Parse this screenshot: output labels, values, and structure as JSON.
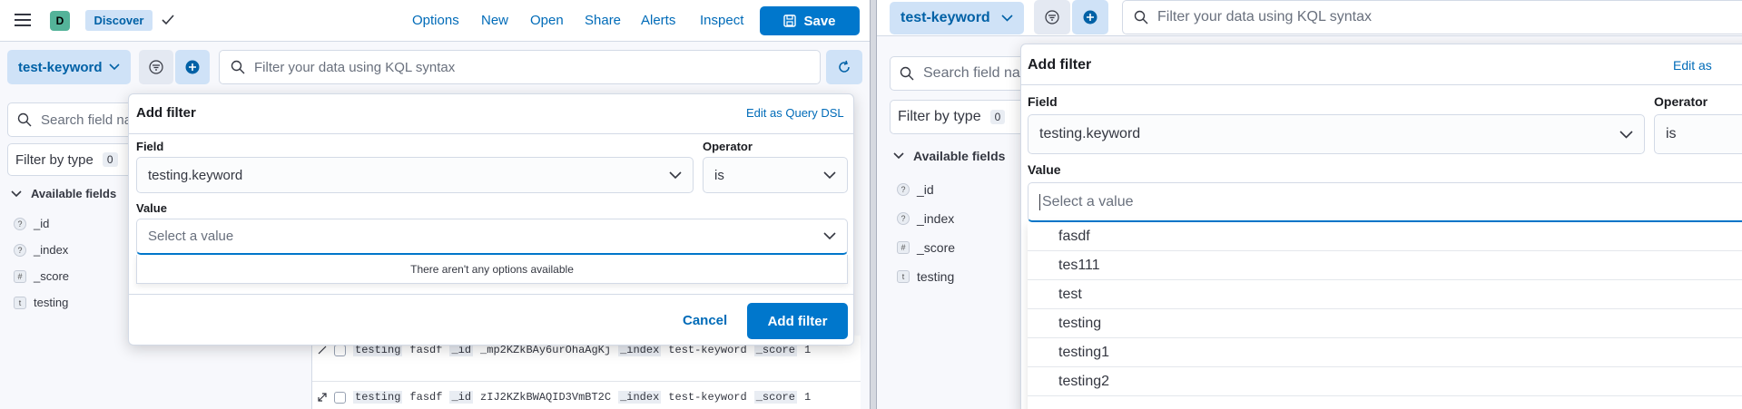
{
  "left": {
    "header": {
      "space_initial": "D",
      "app_badge": "Discover",
      "links": [
        "Options",
        "New",
        "Open",
        "Share",
        "Alerts",
        "Inspect"
      ],
      "save_label": "Save"
    },
    "query_bar": {
      "data_view": "test-keyword",
      "kql_placeholder": "Filter your data using KQL syntax"
    },
    "sidebar": {
      "search_placeholder": "Search field names",
      "filter_by_type": "Filter by type",
      "filter_count": "0",
      "available_fields": "Available fields",
      "fields": [
        {
          "type": "?",
          "name": "_id"
        },
        {
          "type": "?",
          "name": "_index"
        },
        {
          "type": "#",
          "name": "_score"
        },
        {
          "type": "t",
          "name": "testing"
        }
      ]
    },
    "docs": [
      {
        "k1": "testing",
        "v1": "fasdf",
        "k2": "_id",
        "v2": "_mp2KZkBAy6urOhaAgKj",
        "k3": "_index",
        "v3": "test-keyword",
        "k4": "_score",
        "v4": "1"
      },
      {
        "k1": "testing",
        "v1": "fasdf",
        "k2": "_id",
        "v2": "zIJ2KZkBWAQID3VmBT2C",
        "k3": "_index",
        "v3": "test-keyword",
        "k4": "_score",
        "v4": "1"
      }
    ],
    "popover": {
      "title": "Add filter",
      "edit_dsl": "Edit as Query DSL",
      "field_label": "Field",
      "field_value": "testing.keyword",
      "operator_label": "Operator",
      "operator_value": "is",
      "value_label": "Value",
      "value_placeholder": "Select a value",
      "no_options": "There aren't any options available",
      "cancel": "Cancel",
      "add": "Add filter"
    }
  },
  "right": {
    "query_bar": {
      "data_view": "test-keyword",
      "kql_placeholder": "Filter your data using KQL syntax"
    },
    "sidebar": {
      "search_placeholder": "Search field names",
      "filter_by_type": "Filter by type",
      "filter_count": "0",
      "available_fields": "Available fields",
      "fields": [
        {
          "type": "?",
          "name": "_id"
        },
        {
          "type": "?",
          "name": "_index"
        },
        {
          "type": "#",
          "name": "_score"
        },
        {
          "type": "t",
          "name": "testing"
        }
      ]
    },
    "popover": {
      "title": "Add filter",
      "edit_dsl": "Edit as",
      "field_label": "Field",
      "field_value": "testing.keyword",
      "operator_label": "Operator",
      "operator_value": "is",
      "value_label": "Value",
      "value_placeholder": "Select a value",
      "options": [
        "fasdf",
        "tes111",
        "test",
        "testing",
        "testing1",
        "testing2"
      ]
    }
  },
  "colors": {
    "primary": "#0077cc",
    "link": "#006bb8",
    "badge_bg": "#cfe2f7",
    "avatar": "#54b399"
  }
}
